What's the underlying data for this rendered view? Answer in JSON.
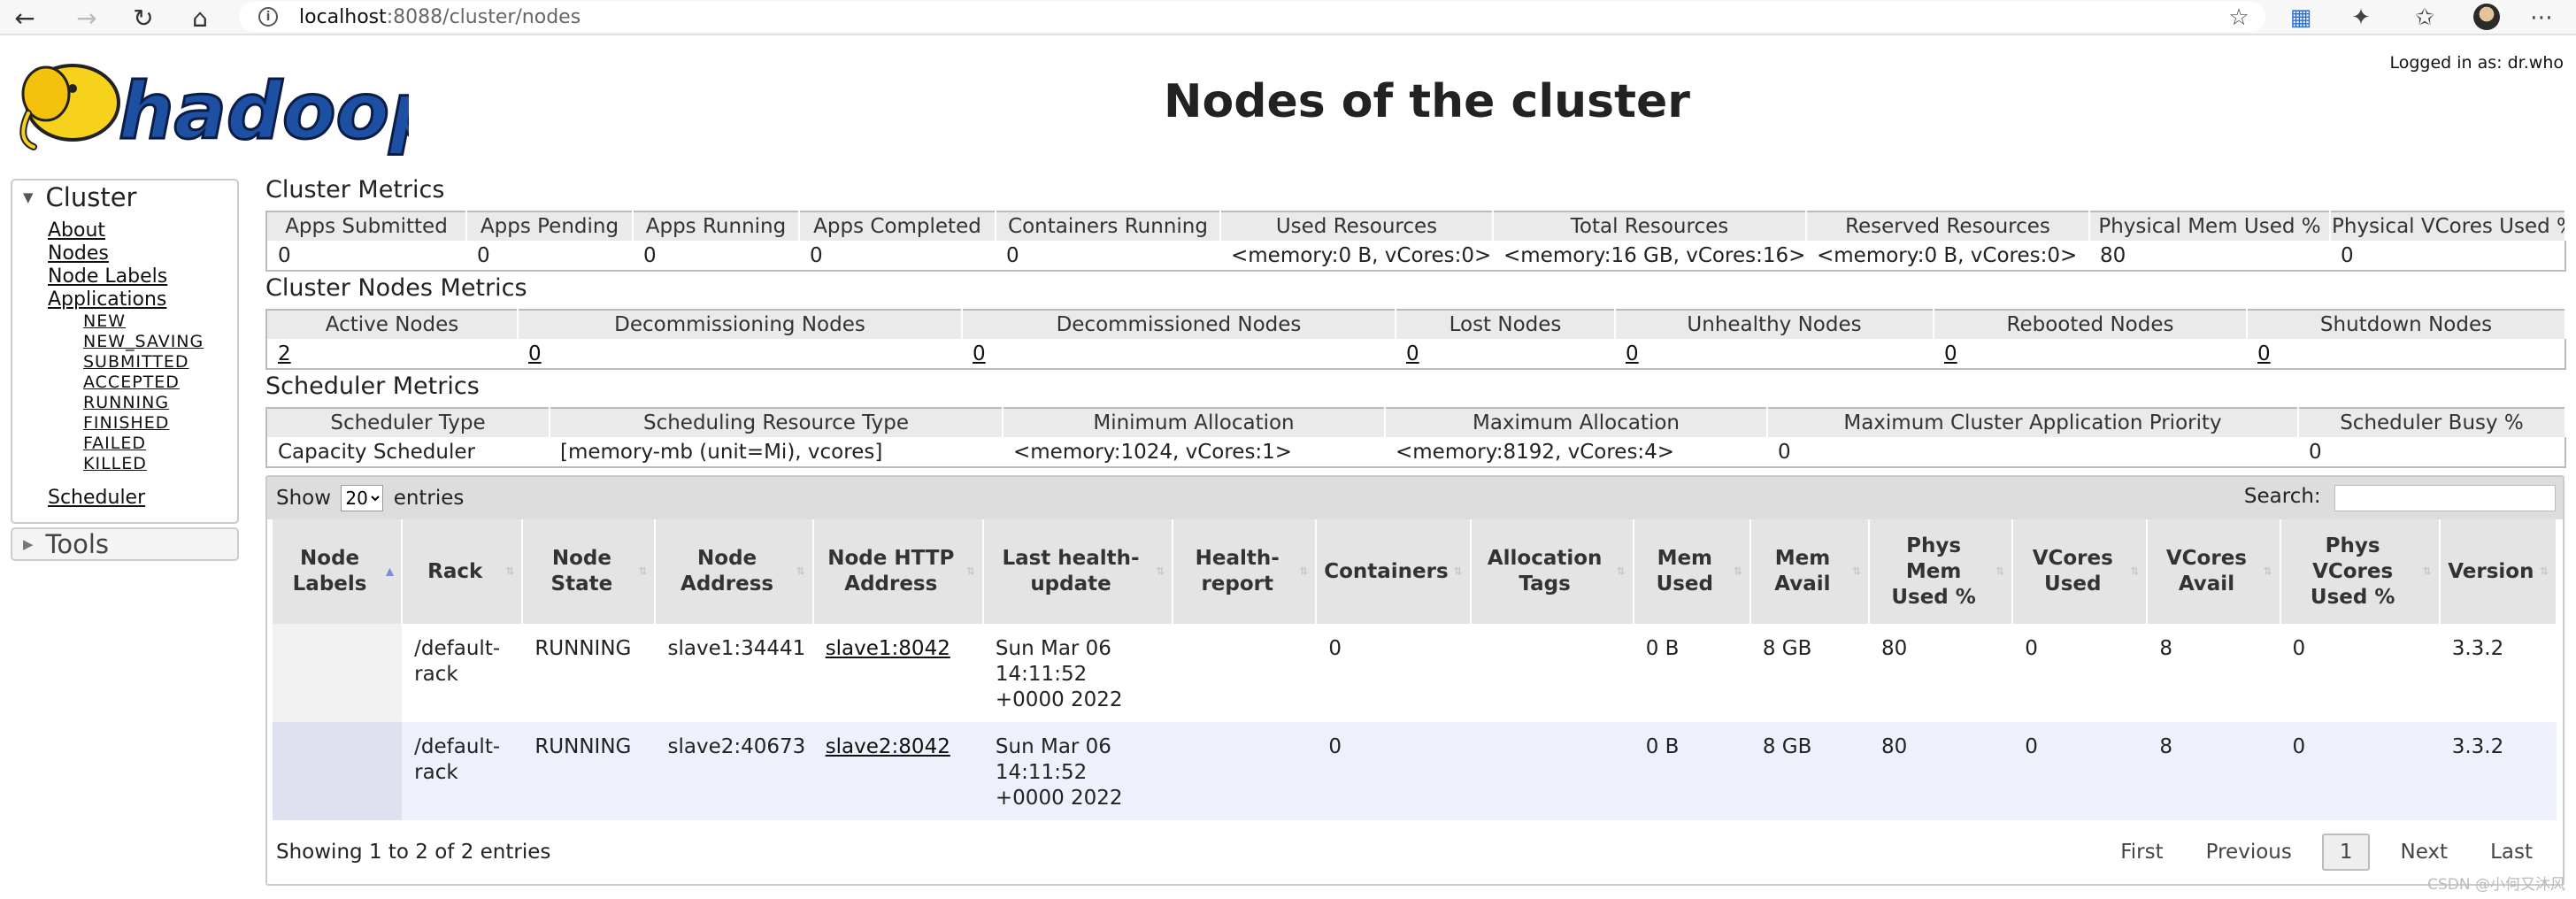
{
  "browser": {
    "url_host": "localhost",
    "url_path": ":8088/cluster/nodes"
  },
  "header": {
    "title": "Nodes of the cluster",
    "logged_in": "Logged in as: dr.who",
    "logo_text": "hadoop"
  },
  "sidebar": {
    "cluster_label": "Cluster",
    "links": [
      "About",
      "Nodes",
      "Node Labels",
      "Applications"
    ],
    "app_states": [
      "NEW",
      "NEW_SAVING",
      "SUBMITTED",
      "ACCEPTED",
      "RUNNING",
      "FINISHED",
      "FAILED",
      "KILLED"
    ],
    "scheduler": "Scheduler",
    "tools_label": "Tools"
  },
  "cluster_metrics": {
    "title": "Cluster Metrics",
    "headers": [
      "Apps Submitted",
      "Apps Pending",
      "Apps Running",
      "Apps Completed",
      "Containers Running",
      "Used Resources",
      "Total Resources",
      "Reserved Resources",
      "Physical Mem Used %",
      "Physical VCores Used %"
    ],
    "values": [
      "0",
      "0",
      "0",
      "0",
      "0",
      "<memory:0 B, vCores:0>",
      "<memory:16 GB, vCores:16>",
      "<memory:0 B, vCores:0>",
      "80",
      "0"
    ]
  },
  "node_metrics": {
    "title": "Cluster Nodes Metrics",
    "headers": [
      "Active Nodes",
      "Decommissioning Nodes",
      "Decommissioned Nodes",
      "Lost Nodes",
      "Unhealthy Nodes",
      "Rebooted Nodes",
      "Shutdown Nodes"
    ],
    "values": [
      "2",
      "0",
      "0",
      "0",
      "0",
      "0",
      "0"
    ]
  },
  "scheduler_metrics": {
    "title": "Scheduler Metrics",
    "headers": [
      "Scheduler Type",
      "Scheduling Resource Type",
      "Minimum Allocation",
      "Maximum Allocation",
      "Maximum Cluster Application Priority",
      "Scheduler Busy %"
    ],
    "values": [
      "Capacity Scheduler",
      "[memory-mb (unit=Mi), vcores]",
      "<memory:1024, vCores:1>",
      "<memory:8192, vCores:4>",
      "0",
      "0"
    ]
  },
  "nodes_table": {
    "show_label": "Show",
    "page_size": "20",
    "entries_label": "entries",
    "search_label": "Search:",
    "headers": [
      "Node Labels",
      "Rack",
      "Node State",
      "Node Address",
      "Node HTTP Address",
      "Last health-update",
      "Health-report",
      "Containers",
      "Allocation Tags",
      "Mem Used",
      "Mem Avail",
      "Phys Mem Used %",
      "VCores Used",
      "VCores Avail",
      "Phys VCores Used %",
      "Version"
    ],
    "rows": [
      [
        "",
        "/default-rack",
        "RUNNING",
        "slave1:34441",
        "slave1:8042",
        "Sun Mar 06 14:11:52 +0000 2022",
        "",
        "0",
        "",
        "0 B",
        "8 GB",
        "80",
        "0",
        "8",
        "0",
        "3.3.2"
      ],
      [
        "",
        "/default-rack",
        "RUNNING",
        "slave2:40673",
        "slave2:8042",
        "Sun Mar 06 14:11:52 +0000 2022",
        "",
        "0",
        "",
        "0 B",
        "8 GB",
        "80",
        "0",
        "8",
        "0",
        "3.3.2"
      ]
    ],
    "info": "Showing 1 to 2 of 2 entries",
    "pager": {
      "first": "First",
      "previous": "Previous",
      "current": "1",
      "next": "Next",
      "last": "Last"
    }
  },
  "watermark": "CSDN @小何又沐风"
}
